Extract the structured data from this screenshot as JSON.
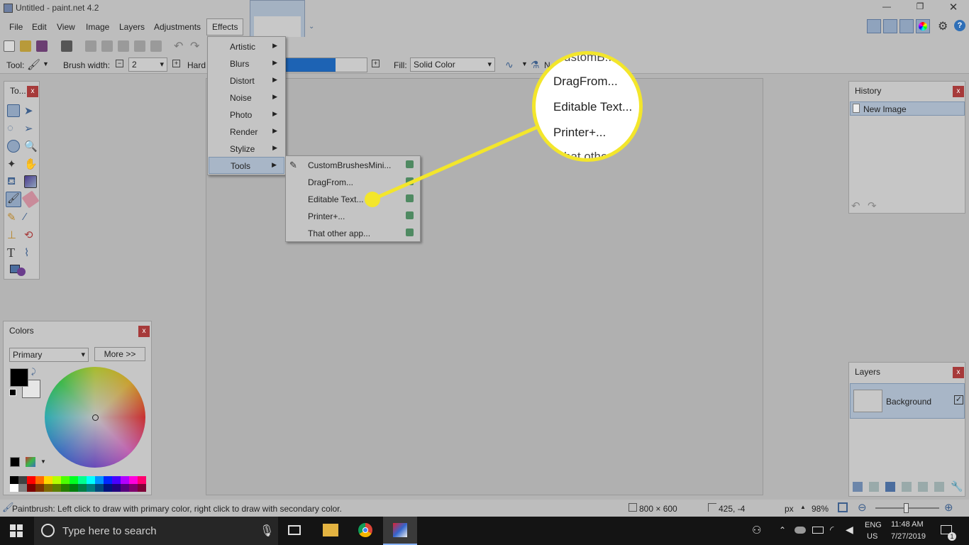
{
  "app": {
    "title": "Untitled - paint.net 4.2"
  },
  "menubar": [
    "File",
    "Edit",
    "View",
    "Image",
    "Layers",
    "Adjustments",
    "Effects"
  ],
  "toolbar": {
    "tool_label": "Tool:",
    "brush_width_label": "Brush width:",
    "brush_width_value": "2",
    "hardness_label": "Hard",
    "fill_label": "Fill:",
    "fill_value": "Solid Color",
    "antialias_label": "N"
  },
  "tools_panel": {
    "title": "To..."
  },
  "effects_menu": {
    "items": [
      "Artistic",
      "Blurs",
      "Distort",
      "Noise",
      "Photo",
      "Render",
      "Stylize",
      "Tools"
    ],
    "highlighted": "Tools"
  },
  "tools_submenu": {
    "items": [
      "CustomBrushesMini...",
      "DragFrom...",
      "Editable Text...",
      "Printer+...",
      "That other app..."
    ]
  },
  "magnifier": {
    "lines": [
      "ustomB...",
      "DragFrom...",
      "Editable Text...",
      "Printer+...",
      "hat othe..."
    ],
    "callout_color": "#f3e62b"
  },
  "history_panel": {
    "title": "History",
    "items": [
      "New Image"
    ]
  },
  "layers_panel": {
    "title": "Layers",
    "items": [
      {
        "name": "Background",
        "visible": true
      }
    ]
  },
  "colors_panel": {
    "title": "Colors",
    "mode": "Primary",
    "more_label": "More >>",
    "primary": "#000000",
    "secondary": "#ffffff",
    "palette_top": [
      "#000000",
      "#404040",
      "#ff0000",
      "#ff6a00",
      "#ffd800",
      "#b6ff00",
      "#4cff00",
      "#00ff21",
      "#00ff90",
      "#00ffff",
      "#0094ff",
      "#0026ff",
      "#4800ff",
      "#b200ff",
      "#ff00dc",
      "#ff006e"
    ],
    "palette_bottom": [
      "#ffffff",
      "#808080",
      "#7f0000",
      "#7f3300",
      "#7f6a00",
      "#5b7f00",
      "#267f00",
      "#007f0e",
      "#007f46",
      "#007f7f",
      "#004a7f",
      "#00137f",
      "#21007f",
      "#57007f",
      "#7f006e",
      "#7f0037"
    ]
  },
  "status": {
    "hint": "Paintbrush: Left click to draw with primary color, right click to draw with secondary color.",
    "image_size": "800 × 600",
    "cursor_pos": "425, -4",
    "unit": "px",
    "zoom": "98%"
  },
  "taskbar": {
    "search_placeholder": "Type here to search",
    "lang_line1": "ENG",
    "lang_line2": "US",
    "time": "11:48 AM",
    "date": "7/27/2019",
    "notifications": "1"
  }
}
